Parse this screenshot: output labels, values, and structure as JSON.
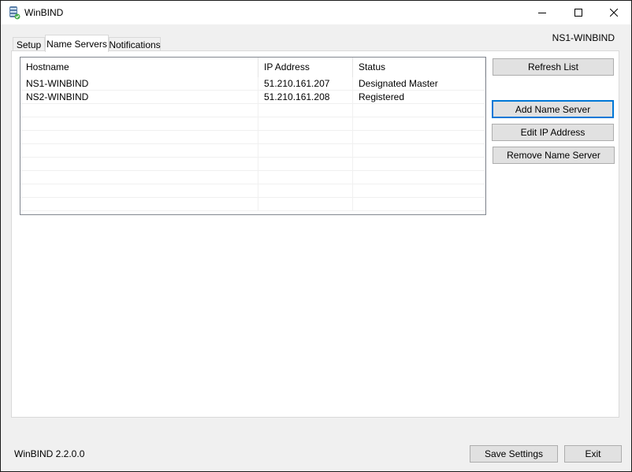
{
  "window": {
    "title": "WinBIND",
    "controls": {
      "minimize": "minimize-icon",
      "maximize": "maximize-icon",
      "close": "close-icon"
    }
  },
  "server_name": "NS1-WINBIND",
  "tabs": [
    {
      "label": "Setup",
      "active": false
    },
    {
      "label": "Name Servers",
      "active": true
    },
    {
      "label": "Notifications",
      "active": false
    }
  ],
  "table": {
    "columns": [
      "Hostname",
      "IP Address",
      "Status"
    ],
    "rows": [
      [
        "NS1-WINBIND",
        "51.210.161.207",
        "Designated Master"
      ],
      [
        "NS2-WINBIND",
        "51.210.161.208",
        "Registered"
      ],
      [
        "",
        "",
        ""
      ],
      [
        "",
        "",
        ""
      ],
      [
        "",
        "",
        ""
      ],
      [
        "",
        "",
        ""
      ],
      [
        "",
        "",
        ""
      ],
      [
        "",
        "",
        ""
      ],
      [
        "",
        "",
        ""
      ],
      [
        "",
        "",
        ""
      ]
    ]
  },
  "buttons": {
    "refresh": "Refresh List",
    "add": "Add Name Server",
    "edit": "Edit IP Address",
    "remove": "Remove Name Server",
    "save": "Save Settings",
    "exit": "Exit"
  },
  "footer": {
    "version": "WinBIND 2.2.0.0"
  }
}
